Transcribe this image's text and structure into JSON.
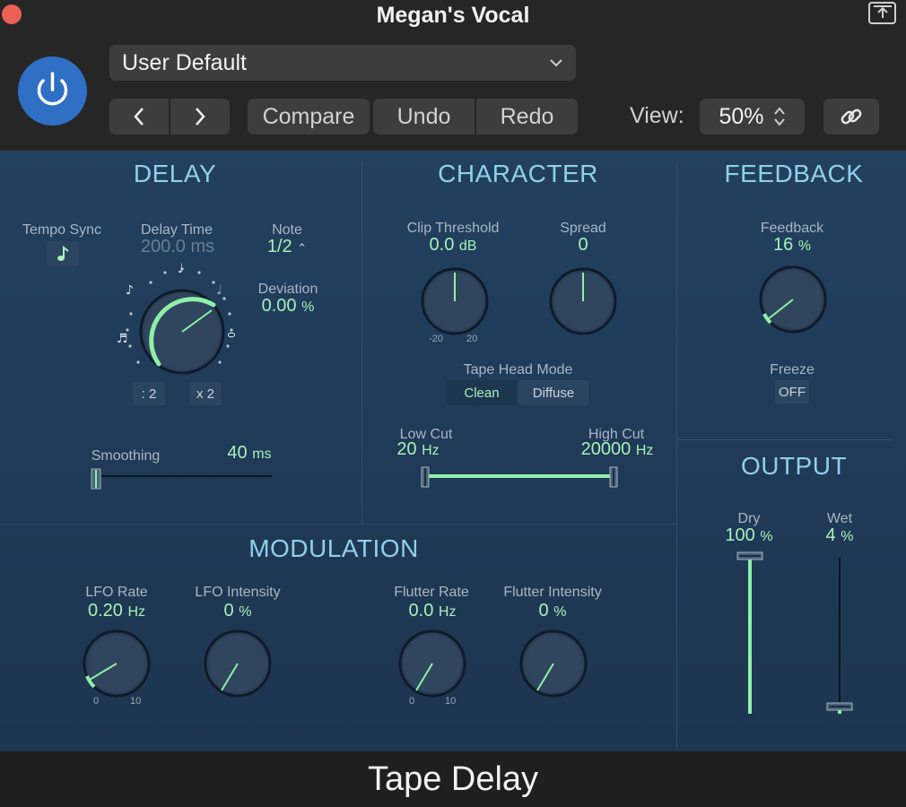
{
  "window": {
    "title": "Megan's Vocal"
  },
  "toolbar": {
    "preset": "User Default",
    "prev_label": "<",
    "next_label": ">",
    "compare": "Compare",
    "undo": "Undo",
    "redo": "Redo",
    "view_label": "View:",
    "zoom": "50%"
  },
  "delay": {
    "title": "DELAY",
    "tempo_sync_label": "Tempo Sync",
    "delay_time_label": "Delay Time",
    "delay_time_value": "200.0 ms",
    "note_label": "Note",
    "note_value": "1/2",
    "deviation_label": "Deviation",
    "deviation_value": "0.00",
    "deviation_unit": "%",
    "div2": ": 2",
    "x2": "x 2",
    "smoothing_label": "Smoothing",
    "smoothing_value": "40",
    "smoothing_unit": "ms",
    "knob_note_mark": "0"
  },
  "character": {
    "title": "CHARACTER",
    "clip_label": "Clip Threshold",
    "clip_value": "0.0",
    "clip_unit": "dB",
    "clip_min": "-20",
    "clip_max": "20",
    "spread_label": "Spread",
    "spread_value": "0",
    "tape_head_label": "Tape Head Mode",
    "mode_clean": "Clean",
    "mode_diffuse": "Diffuse",
    "low_cut_label": "Low Cut",
    "low_cut_value": "20",
    "low_cut_unit": "Hz",
    "high_cut_label": "High Cut",
    "high_cut_value": "20000",
    "high_cut_unit": "Hz"
  },
  "feedback": {
    "title": "FEEDBACK",
    "feedback_label": "Feedback",
    "feedback_value": "16",
    "feedback_unit": "%",
    "freeze_label": "Freeze",
    "freeze_value": "OFF"
  },
  "output": {
    "title": "OUTPUT",
    "dry_label": "Dry",
    "dry_value": "100",
    "dry_unit": "%",
    "wet_label": "Wet",
    "wet_value": "4",
    "wet_unit": "%"
  },
  "modulation": {
    "title": "MODULATION",
    "lfo_rate_label": "LFO Rate",
    "lfo_rate_value": "0.20",
    "lfo_rate_unit": "Hz",
    "lfo_rate_min": "0",
    "lfo_rate_max": "10",
    "lfo_int_label": "LFO Intensity",
    "lfo_int_value": "0",
    "lfo_int_unit": "%",
    "flutter_rate_label": "Flutter Rate",
    "flutter_rate_value": "0.0",
    "flutter_rate_unit": "Hz",
    "flutter_rate_min": "0",
    "flutter_rate_max": "10",
    "flutter_int_label": "Flutter Intensity",
    "flutter_int_value": "0",
    "flutter_int_unit": "%"
  },
  "footer": {
    "plugin_name": "Tape Delay"
  },
  "colors": {
    "accent_green": "#8ef0a6",
    "title_blue": "#8fd0ea",
    "power_blue": "#2f6fc4"
  }
}
